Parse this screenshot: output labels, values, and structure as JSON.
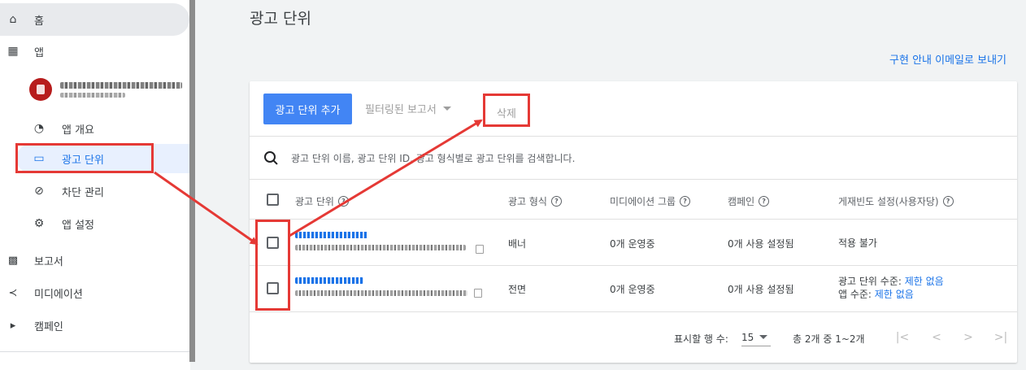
{
  "sidebar": {
    "home": {
      "label": "홈",
      "icon": "home-icon"
    },
    "apps": {
      "label": "앱",
      "icon": "apps-grid-icon"
    },
    "app_sub": [
      {
        "label": "앱 개요",
        "icon": "speedometer-icon"
      },
      {
        "label": "광고 단위",
        "icon": "ad-unit-icon"
      },
      {
        "label": "차단 관리",
        "icon": "block-icon"
      },
      {
        "label": "앱 설정",
        "icon": "settings-icon"
      }
    ],
    "main": [
      {
        "label": "보고서",
        "icon": "report-icon"
      },
      {
        "label": "미디에이션",
        "icon": "mediation-icon"
      },
      {
        "label": "캠페인",
        "icon": "campaign-icon"
      }
    ]
  },
  "page": {
    "title": "광고 단위",
    "send_link": "구현 안내 이메일로 보내기"
  },
  "toolbar": {
    "add_label": "광고 단위 추가",
    "filtered_label": "필터링된 보고서",
    "delete_label": "삭제"
  },
  "search": {
    "placeholder": "광고 단위 이름, 광고 단위 ID, 광고 형식별로 광고 단위를 검색합니다."
  },
  "table": {
    "headers": [
      "광고 단위",
      "광고 형식",
      "미디에이션 그룹",
      "캠페인",
      "게재빈도 설정(사용자당)"
    ],
    "rows": [
      {
        "format": "배너",
        "mediation": "0개 운영중",
        "campaign": "0개 사용 설정됨",
        "frequency": "적용 불가"
      },
      {
        "format": "전면",
        "mediation": "0개 운영중",
        "campaign": "0개 사용 설정됨",
        "frequency_line1_label": "광고 단위 수준: ",
        "frequency_line1_value": "제한 없음",
        "frequency_line2_label": "앱 수준: ",
        "frequency_line2_value": "제한 없음"
      }
    ]
  },
  "pagination": {
    "rows_per_page_label": "표시할 행 수:",
    "rows_per_page": "15",
    "range": "총 2개 중 1~2개",
    "first": "|<",
    "prev": "<",
    "next": ">",
    "last": ">|"
  },
  "colors": {
    "primary": "#4285f4",
    "link": "#1a73e8",
    "annotation": "#e53935"
  }
}
